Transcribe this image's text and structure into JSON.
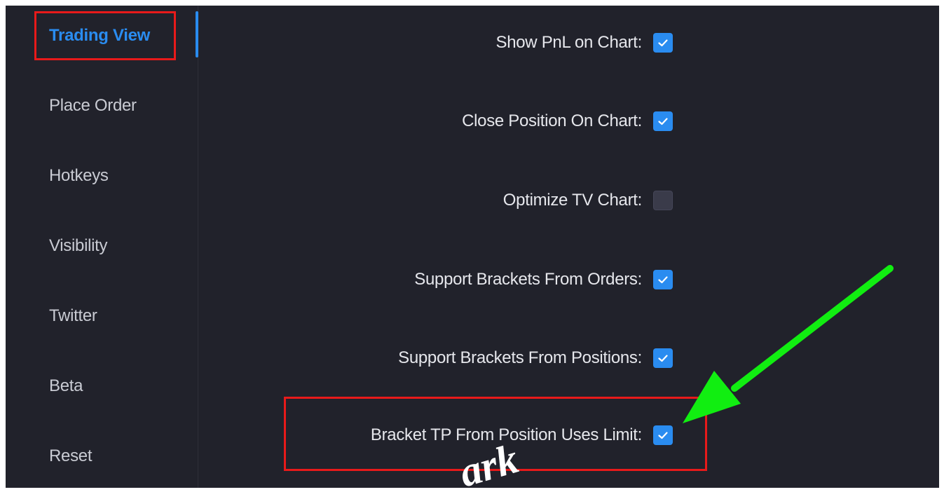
{
  "sidebar": {
    "items": [
      {
        "label": "Trading View",
        "active": true
      },
      {
        "label": "Place Order"
      },
      {
        "label": "Hotkeys"
      },
      {
        "label": "Visibility"
      },
      {
        "label": "Twitter"
      },
      {
        "label": "Beta"
      },
      {
        "label": "Reset"
      }
    ]
  },
  "settings": [
    {
      "label": "Show PnL on Chart:",
      "checked": true
    },
    {
      "label": "Close Position On Chart:",
      "checked": true
    },
    {
      "label": "Optimize TV Chart:",
      "checked": false
    },
    {
      "label": "Support Brackets From Orders:",
      "checked": true
    },
    {
      "label": "Support Brackets From Positions:",
      "checked": true
    },
    {
      "label": "Bracket TP From Position Uses Limit:",
      "checked": true
    }
  ],
  "annotations": {
    "highlight_color": "#e81a1a",
    "arrow_color": "#11ee11",
    "accent_color": "#2a8cf0"
  },
  "watermark": {
    "text": "ark"
  }
}
